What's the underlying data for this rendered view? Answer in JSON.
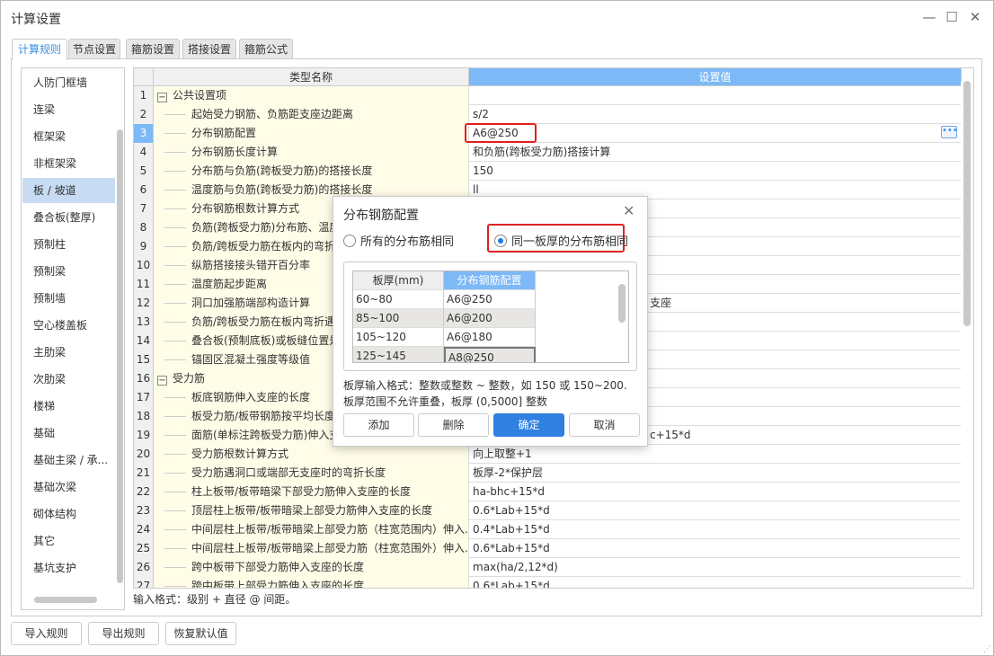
{
  "window": {
    "title": "计算设置"
  },
  "tabs": [
    "计算规则",
    "节点设置",
    "箍筋设置",
    "搭接设置",
    "箍筋公式"
  ],
  "sidebar": {
    "selected": "板 / 坡道",
    "items": [
      "人防门框墙",
      "连梁",
      "框架梁",
      "非框架梁",
      "板 / 坡道",
      "叠合板(整厚)",
      "预制柱",
      "预制梁",
      "预制墙",
      "空心楼盖板",
      "主肋梁",
      "次肋梁",
      "楼梯",
      "基础",
      "基础主梁 / 承...",
      "基础次梁",
      "砌体结构",
      "其它",
      "基坑支护"
    ]
  },
  "grid": {
    "headers": {
      "name": "类型名称",
      "value": "设置值"
    },
    "current_row": 3,
    "rows": [
      {
        "n": "1",
        "name": "公共设置项",
        "value": "",
        "group": true
      },
      {
        "n": "2",
        "name": "起始受力钢筋、负筋距支座边距离",
        "value": "s/2"
      },
      {
        "n": "3",
        "name": "分布钢筋配置",
        "value": "A6@250"
      },
      {
        "n": "4",
        "name": "分布钢筋长度计算",
        "value": "和负筋(跨板受力筋)搭接计算"
      },
      {
        "n": "5",
        "name": "分布筋与负筋(跨板受力筋)的搭接长度",
        "value": "150"
      },
      {
        "n": "6",
        "name": "温度筋与负筋(跨板受力筋)的搭接长度",
        "value": "ll"
      },
      {
        "n": "7",
        "name": "分布钢筋根数计算方式",
        "value": ""
      },
      {
        "n": "8",
        "name": "负筋(跨板受力筋)分布筋、温度筋",
        "value": ""
      },
      {
        "n": "9",
        "name": "负筋/跨板受力筋在板内的弯折长",
        "value": ""
      },
      {
        "n": "10",
        "name": "纵筋搭接接头错开百分率",
        "value": ""
      },
      {
        "n": "11",
        "name": "温度筋起步距离",
        "value": ""
      },
      {
        "n": "12",
        "name": "洞口加强筋端部构造计算",
        "value": "支座",
        "partial": true
      },
      {
        "n": "13",
        "name": "负筋/跨板受力筋在板内弯折遇预",
        "value": ""
      },
      {
        "n": "14",
        "name": "叠合板(预制底板)或板缝位置是否",
        "value": ""
      },
      {
        "n": "15",
        "name": "锚固区混凝土强度等级值",
        "value": ""
      },
      {
        "n": "16",
        "name": "受力筋",
        "value": "",
        "group": true
      },
      {
        "n": "17",
        "name": "板底钢筋伸入支座的长度",
        "value": ""
      },
      {
        "n": "18",
        "name": "板受力筋/板带钢筋按平均长度计",
        "value": ""
      },
      {
        "n": "19",
        "name": "面筋(单标注跨板受力筋)伸入支座",
        "value": "c+15*d",
        "partial": true
      },
      {
        "n": "20",
        "name": "受力筋根数计算方式",
        "value": "向上取整+1"
      },
      {
        "n": "21",
        "name": "受力筋遇洞口或端部无支座时的弯折长度",
        "value": "板厚-2*保护层"
      },
      {
        "n": "22",
        "name": "柱上板带/板带暗梁下部受力筋伸入支座的长度",
        "value": "ha-bhc+15*d"
      },
      {
        "n": "23",
        "name": "顶层柱上板带/板带暗梁上部受力筋伸入支座的长度",
        "value": "0.6*Lab+15*d"
      },
      {
        "n": "24",
        "name": "中间层柱上板带/板带暗梁上部受力筋（柱宽范围内）伸入...",
        "value": "0.4*Lab+15*d"
      },
      {
        "n": "25",
        "name": "中间层柱上板带/板带暗梁上部受力筋（柱宽范围外）伸入...",
        "value": "0.6*Lab+15*d"
      },
      {
        "n": "26",
        "name": "跨中板带下部受力筋伸入支座的长度",
        "value": "max(ha/2,12*d)"
      },
      {
        "n": "27",
        "name": "跨中板带上部受力筋伸入支座的长度",
        "value": "0.6*Lab+15*d"
      }
    ]
  },
  "hint": "输入格式：级别 + 直径 @ 间距。",
  "buttons": {
    "import": "导入规则",
    "export": "导出规则",
    "restore": "恢复默认值"
  },
  "dialog": {
    "title": "分布钢筋配置",
    "radio_all": "所有的分布筋相同",
    "radio_thickness": "同一板厚的分布筋相同",
    "selected_radio": "同一板厚的分布筋相同",
    "table_headers": [
      "板厚(mm)",
      "分布钢筋配置"
    ],
    "table_rows": [
      [
        "60~80",
        "A6@250"
      ],
      [
        "85~100",
        "A6@200"
      ],
      [
        "105~120",
        "A6@180"
      ],
      [
        "125~145",
        "A8@250"
      ]
    ],
    "help1": "板厚输入格式：整数或整数 ~ 整数，如 150 或 150~200.",
    "help2": "板厚范围不允许重叠，板厚 (0,5000] 整数",
    "add": "添加",
    "delete": "删除",
    "ok": "确定",
    "cancel": "取消"
  },
  "colors": {
    "accent": "#2f80e0",
    "header_selected": "#7db9f7",
    "highlight_box": "#e02020",
    "name_bg": "#fffde8"
  }
}
